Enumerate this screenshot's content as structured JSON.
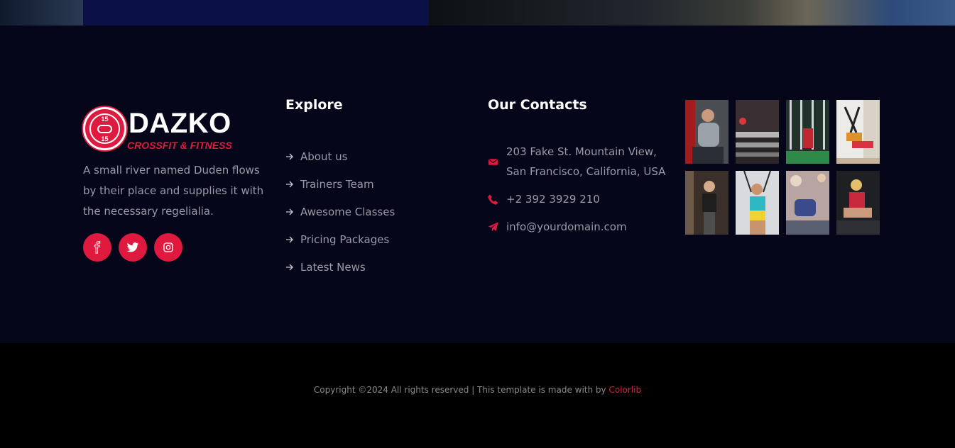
{
  "brand": {
    "name": "DAZKO",
    "tagline": "CROSSFIT & FITNESS",
    "badge_top": "15",
    "badge_bottom": "15",
    "accent_color": "#e0193f",
    "description": "A small river named Duden flows by their place and supplies it with the necessary regelialia."
  },
  "socials": [
    {
      "icon": "facebook-icon"
    },
    {
      "icon": "twitter-icon"
    },
    {
      "icon": "instagram-icon"
    }
  ],
  "explore": {
    "heading": "Explore",
    "items": [
      {
        "label": "About us"
      },
      {
        "label": "Trainers Team"
      },
      {
        "label": "Awesome Classes"
      },
      {
        "label": "Pricing Packages"
      },
      {
        "label": "Latest News"
      }
    ]
  },
  "contacts": {
    "heading": "Our Contacts",
    "address": "203 Fake St. Mountain View, San Francisco, California, USA",
    "phone": "+2 392 3929 210",
    "email": "info@yourdomain.com"
  },
  "gallery": {
    "images": [
      {
        "icon": "gym-photo-1"
      },
      {
        "icon": "gym-photo-2"
      },
      {
        "icon": "gym-photo-3"
      },
      {
        "icon": "gym-photo-4"
      },
      {
        "icon": "gym-photo-5"
      },
      {
        "icon": "gym-photo-6"
      },
      {
        "icon": "gym-photo-7"
      },
      {
        "icon": "gym-photo-8"
      }
    ]
  },
  "footer": {
    "copyright": "Copyright ©2024 All rights reserved | This template is made with by",
    "link_label": "Colorlib"
  }
}
